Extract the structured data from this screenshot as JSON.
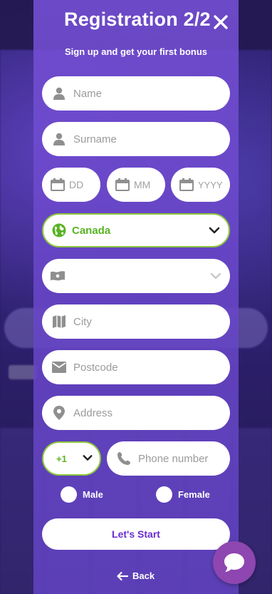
{
  "modal": {
    "title": "Registration 2/2",
    "subtitle": "Sign up and get your first bonus"
  },
  "form": {
    "name_placeholder": "Name",
    "surname_placeholder": "Surname",
    "day_placeholder": "DD",
    "month_placeholder": "MM",
    "year_placeholder": "YYYY",
    "country_value": "Canada",
    "province_value": "",
    "city_placeholder": "City",
    "postcode_placeholder": "Postcode",
    "address_placeholder": "Address",
    "phone_code_value": "+1",
    "phone_placeholder": "Phone number",
    "gender_male": "Male",
    "gender_female": "Female",
    "submit_label": "Let's Start",
    "back_label": "Back"
  },
  "icons": {
    "close": "close-icon",
    "person": "person-icon",
    "calendar": "calendar-icon",
    "globe": "globe-icon",
    "flag": "flag-icon",
    "map": "map-icon",
    "mail": "mail-icon",
    "pin": "location-pin-icon",
    "phone": "phone-icon",
    "chevron": "chevron-down-icon",
    "arrow": "arrow-left-icon",
    "chat": "chat-bubble-icon"
  },
  "colors": {
    "modal": "#7650d6",
    "accent_green": "#59b324",
    "green_border": "#8cc63f",
    "button_text": "#6a2bd0",
    "icon_grey": "#8f8f8f",
    "chat_button": "#8e46b0"
  }
}
